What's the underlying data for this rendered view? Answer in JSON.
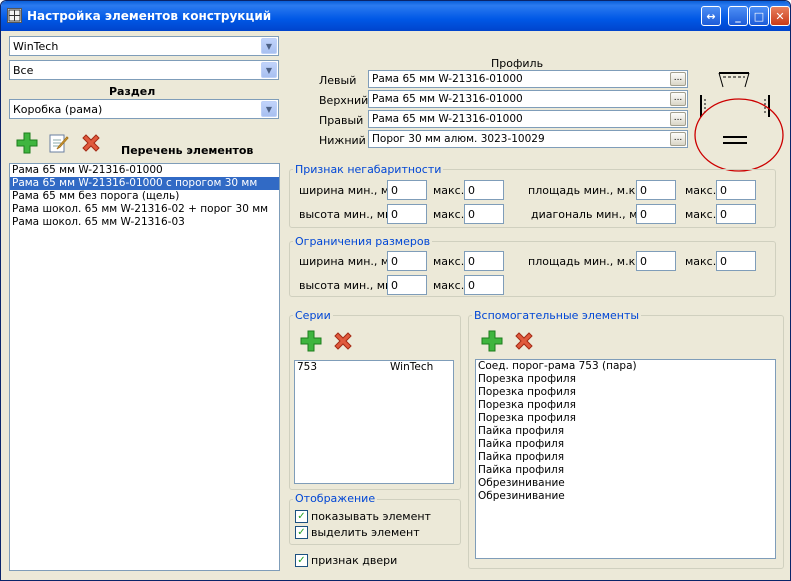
{
  "window": {
    "title": "Настройка элементов конструкций"
  },
  "left": {
    "combo1": "WinTech",
    "combo2": "Все",
    "section_label": "Раздел",
    "section_value": "Коробка (рама)",
    "list_title": "Перечень элементов",
    "items": [
      "Рама  65 мм W-21316-01000",
      "Рама  65 мм W-21316-01000 с порогом 30 мм",
      "Рама 65 мм без порога (щель)",
      "Рама шокол.  65 мм W-21316-02 + порог 30 мм",
      "Рама шокол.  65 мм W-21316-03"
    ],
    "selected_index": 1
  },
  "profile": {
    "header": "Профиль",
    "rows": [
      {
        "label": "Левый",
        "value": "Рама  65 мм W-21316-01000"
      },
      {
        "label": "Верхний",
        "value": "Рама  65 мм W-21316-01000"
      },
      {
        "label": "Правый",
        "value": "Рама  65 мм W-21316-01000"
      },
      {
        "label": "Нижний",
        "value": "Порог 30 мм алюм. 3023-10029"
      }
    ],
    "browse_label": "..."
  },
  "oversize": {
    "title": "Признак негабаритности",
    "width_min_label": "ширина мин., мм.",
    "height_min_label": "высота мин., мм.",
    "max_label": "макс.",
    "area_min_label": "площадь мин., м.кв.",
    "diag_min_label": "диагональ мин., мм.",
    "width_min": "0",
    "width_max": "0",
    "height_min": "0",
    "height_max": "0",
    "area_min": "0",
    "area_max": "0",
    "diag_min": "0",
    "diag_max": "0"
  },
  "limits": {
    "title": "Ограничения размеров",
    "width_min_label": "ширина мин., мм.",
    "height_min_label": "высота мин., мм.",
    "max_label": "макс.",
    "area_min_label": "площадь мин., м.кв.",
    "width_min": "0",
    "width_max": "0",
    "height_min": "0",
    "height_max": "0",
    "area_min": "0",
    "area_max": "0"
  },
  "series": {
    "title": "Серии",
    "rows": [
      {
        "code": "753",
        "system": "WinTech"
      }
    ]
  },
  "aux": {
    "title": "Вспомогательные элементы",
    "items": [
      "Соед. порог-рама 753 (пара)",
      "Порезка профиля",
      "Порезка профиля",
      "Порезка профиля",
      "Порезка профиля",
      "Пайка профиля",
      "Пайка профиля",
      "Пайка профиля",
      "Пайка профиля",
      "Обрезинивание",
      "Обрезинивание"
    ]
  },
  "display": {
    "title": "Отображение",
    "show_element": "показывать элемент",
    "highlight_element": "выделить элемент",
    "door_flag": "признак двери",
    "show_checked": true,
    "highlight_checked": true,
    "door_checked": true
  },
  "colors": {
    "accent": "#0046d5",
    "selection": "#316ac5",
    "annotation": "#cc0000"
  }
}
